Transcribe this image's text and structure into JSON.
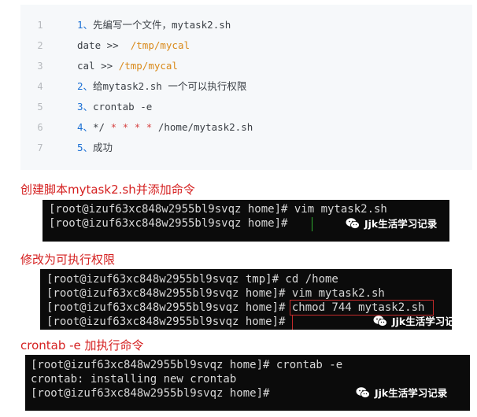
{
  "code": {
    "line_numbers": [
      "1",
      "2",
      "3",
      "4",
      "5",
      "6",
      "7"
    ],
    "l1": {
      "num": "1、",
      "text": "先编写一个文件，mytask2.sh"
    },
    "l2": {
      "cmd": "date >>",
      "path": "/tmp/mycal"
    },
    "l3": {
      "cmd": "cal >>",
      "path": "/tmp/mycal"
    },
    "l4": {
      "num": "2、",
      "text": "给mytask2.sh 一个可以执行权限"
    },
    "l5": {
      "num": "3、",
      "text": "crontab -e"
    },
    "l6": {
      "num": "4、",
      "lead": "*/",
      "stars": "* * * *",
      "path": "/home/mytask2.sh"
    },
    "l7": {
      "num": "5、",
      "text": "成功"
    }
  },
  "sections": [
    {
      "caption": "创建脚本mytask2.sh并添加命令",
      "terminal_lines": [
        "[root@izuf63xc848w2955bl9svqz home]# vim mytask2.sh",
        "[root@izuf63xc848w2955bl9svqz home]#"
      ]
    },
    {
      "caption": "修改为可执行权限",
      "terminal_lines": [
        "[root@izuf63xc848w2955bl9svqz tmp]# cd /home",
        "[root@izuf63xc848w2955bl9svqz home]# vim mytask2.sh",
        "[root@izuf63xc848w2955bl9svqz home]# chmod 744 mytask2.sh",
        "[root@izuf63xc848w2955bl9svqz home]#"
      ]
    },
    {
      "caption": "crontab -e 加执行命令",
      "terminal_lines": [
        "[root@izuf63xc848w2955bl9svqz home]# crontab -e",
        "crontab: installing new crontab",
        "[root@izuf63xc848w2955bl9svqz home]#"
      ]
    }
  ],
  "watermark": {
    "text": "Jjk生活学习记录",
    "icon": "wechat-icon"
  },
  "colors": {
    "caption_red": "#d52121",
    "code_bg": "#f6f8fa",
    "terminal_bg": "#0b0b0b",
    "terminal_text": "#d8d8d8",
    "number_blue": "#1a6fd4",
    "path_orange": "#d98a1b"
  }
}
